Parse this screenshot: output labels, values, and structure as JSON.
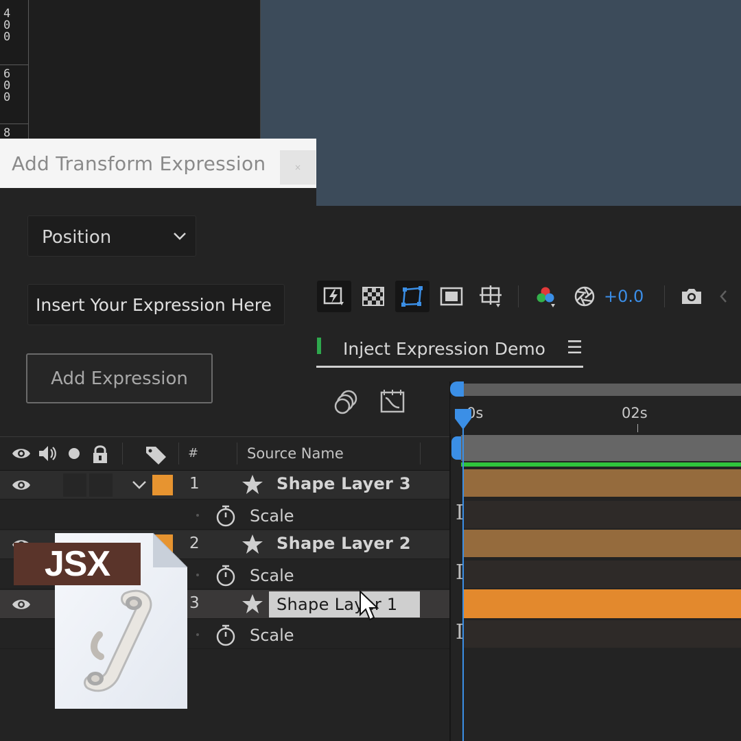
{
  "viewer": {
    "ruler_marks": [
      "400",
      "600",
      "8"
    ]
  },
  "toolbar": {
    "exposure_value": "+0.0",
    "icons": [
      "fast-preview-icon",
      "transparency-grid-icon",
      "mask-path-visibility-icon",
      "region-of-interest-icon",
      "grid-guide-icon",
      "channel-icon",
      "exposure-icon",
      "snapshot-icon"
    ]
  },
  "timeline": {
    "tab_label": "Inject Expression Demo",
    "menu_glyph": "☰",
    "time_labels": {
      "current": "0s",
      "mark_2": "02s"
    },
    "header": {
      "num": "#",
      "source_name": "Source Name"
    }
  },
  "layers": [
    {
      "num": "1",
      "name": "Shape Layer 3",
      "property": "Scale",
      "color": "#e79430"
    },
    {
      "num": "2",
      "name": "Shape Layer 2",
      "property": "Scale",
      "color": "#e79430"
    },
    {
      "num": "3",
      "name": "Shape Layer 1",
      "property": "Scale",
      "color": "#e79430",
      "editing": true
    }
  ],
  "dialog": {
    "title": "Add Transform Expression",
    "close_glyph": "×",
    "property_select": {
      "value": "Position"
    },
    "expression_input": {
      "placeholder": "Insert Your Expression Here",
      "value": ""
    },
    "add_button_label": "Add Expression"
  },
  "file_badge": {
    "label": "JSX",
    "icon": "script-scroll-icon"
  },
  "colors": {
    "accent_blue": "#3b8fe6",
    "layer_label_orange": "#e79430",
    "comp_background": "#3c4b5a",
    "work_area_green": "#2fc43c"
  }
}
